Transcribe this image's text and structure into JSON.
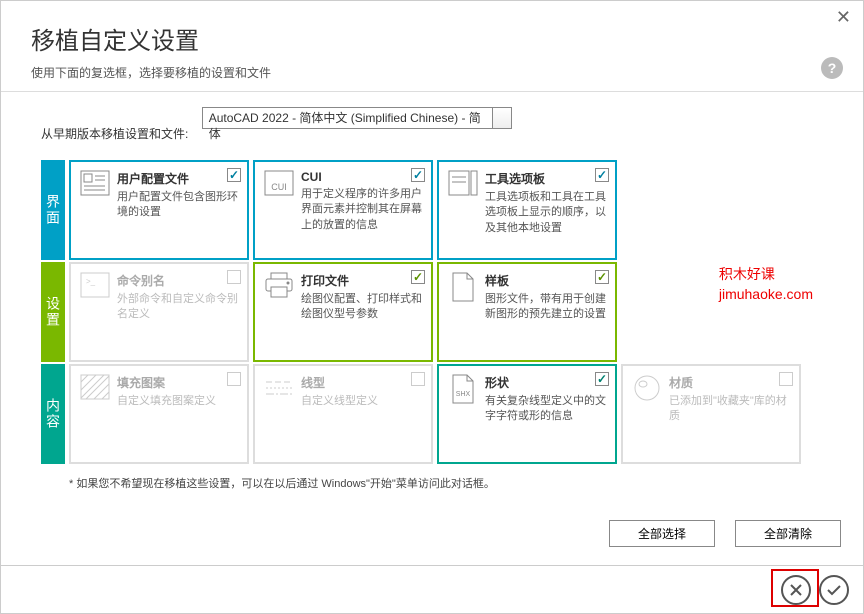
{
  "header": {
    "title": "移植自定义设置",
    "subtitle": "使用下面的复选框，选择要移植的设置和文件"
  },
  "source": {
    "label": "从早期版本移植设置和文件:",
    "selected": "AutoCAD 2022 - 简体中文 (Simplified Chinese) - 简体"
  },
  "sections": [
    {
      "tab": "界面",
      "color": "blue",
      "cards": [
        {
          "title": "用户配置文件",
          "desc": "用户配置文件包含图形环境的设置",
          "checked": true,
          "enabled": true,
          "icon": "profile"
        },
        {
          "title": "CUI",
          "desc": "用于定义程序的许多用户界面元素并控制其在屏幕上的放置的信息",
          "checked": true,
          "enabled": true,
          "icon": "cui"
        },
        {
          "title": "工具选项板",
          "desc": "工具选项板和工具在工具选项板上显示的顺序，以及其他本地设置",
          "checked": true,
          "enabled": true,
          "icon": "palette"
        }
      ]
    },
    {
      "tab": "设置",
      "color": "green",
      "cards": [
        {
          "title": "命令别名",
          "desc": "外部命令和自定义命令别名定义",
          "checked": false,
          "enabled": false,
          "icon": "alias"
        },
        {
          "title": "打印文件",
          "desc": "绘图仪配置、打印样式和绘图仪型号参数",
          "checked": true,
          "enabled": true,
          "icon": "printer"
        },
        {
          "title": "样板",
          "desc": "图形文件，带有用于创建新图形的预先建立的设置",
          "checked": true,
          "enabled": true,
          "icon": "template"
        }
      ]
    },
    {
      "tab": "内容",
      "color": "teal",
      "cards": [
        {
          "title": "填充图案",
          "desc": "自定义填充图案定义",
          "checked": false,
          "enabled": false,
          "icon": "hatch"
        },
        {
          "title": "线型",
          "desc": "自定义线型定义",
          "checked": false,
          "enabled": false,
          "icon": "linetype"
        },
        {
          "title": "形状",
          "desc": "有关复杂线型定义中的文字字符或形的信息",
          "checked": true,
          "enabled": true,
          "icon": "shx"
        },
        {
          "title": "材质",
          "desc": "已添加到\"收藏夹\"库的材质",
          "checked": false,
          "enabled": false,
          "icon": "material"
        }
      ]
    }
  ],
  "footer": {
    "note": "* 如果您不希望现在移植这些设置，可以在以后通过 Windows\"开始\"菜单访问此对话框。",
    "select_all": "全部选择",
    "clear_all": "全部清除"
  },
  "watermark": {
    "line1": "积木好课",
    "line2": "jimuhaoke.com"
  }
}
